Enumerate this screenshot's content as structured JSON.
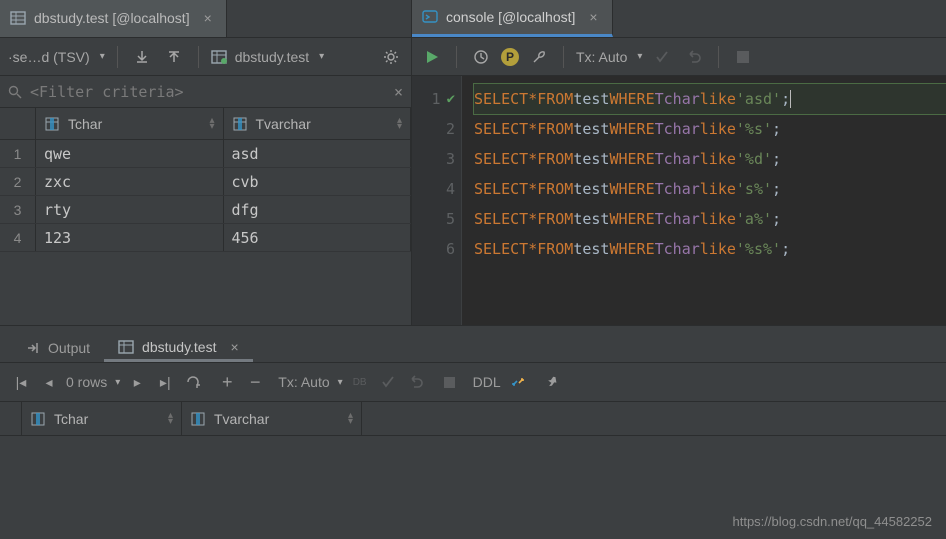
{
  "left": {
    "tab_title": "dbstudy.test [@localhost]",
    "toolbar": {
      "result_label": "·se…d (TSV)",
      "target_label": "dbstudy.test"
    },
    "filter_placeholder": "<Filter criteria>",
    "columns": [
      "Tchar",
      "Tvarchar"
    ],
    "rows": [
      {
        "n": "1",
        "c1": "qwe",
        "c2": "asd"
      },
      {
        "n": "2",
        "c1": "zxc",
        "c2": "cvb"
      },
      {
        "n": "3",
        "c1": "rty",
        "c2": "dfg"
      },
      {
        "n": "4",
        "c1": "123",
        "c2": "456"
      }
    ]
  },
  "right": {
    "tab_title": "console [@localhost]",
    "toolbar": {
      "tx_label": "Tx: Auto"
    },
    "gutter": [
      "1",
      "2",
      "3",
      "4",
      "5",
      "6"
    ],
    "lines": [
      {
        "t": "test",
        "c": "Tchar",
        "s": "'asd'",
        "hl": true
      },
      {
        "t": "test",
        "c": "Tchar",
        "s": "'%s'",
        "hl": false
      },
      {
        "t": "test",
        "c": "Tchar",
        "s": "'%d'",
        "hl": false
      },
      {
        "t": "test",
        "c": "Tchar",
        "s": "'s%'",
        "hl": false
      },
      {
        "t": "test",
        "c": "Tchar",
        "s": "'a%'",
        "hl": false
      },
      {
        "t": "test",
        "c": "Tchar",
        "s": "'%s%'",
        "hl": false
      }
    ],
    "kw": {
      "select": "SELECT",
      "from": "FROM",
      "where": "WHERE",
      "like": "like"
    }
  },
  "bottom": {
    "tabs": {
      "output": "Output",
      "grid": "dbstudy.test"
    },
    "toolbar": {
      "rows_label": "0 rows",
      "tx_label": "Tx: Auto",
      "ddl": "DDL",
      "db": "DB"
    },
    "columns": [
      "Tchar",
      "Tvarchar"
    ]
  },
  "watermark": "https://blog.csdn.net/qq_44582252"
}
